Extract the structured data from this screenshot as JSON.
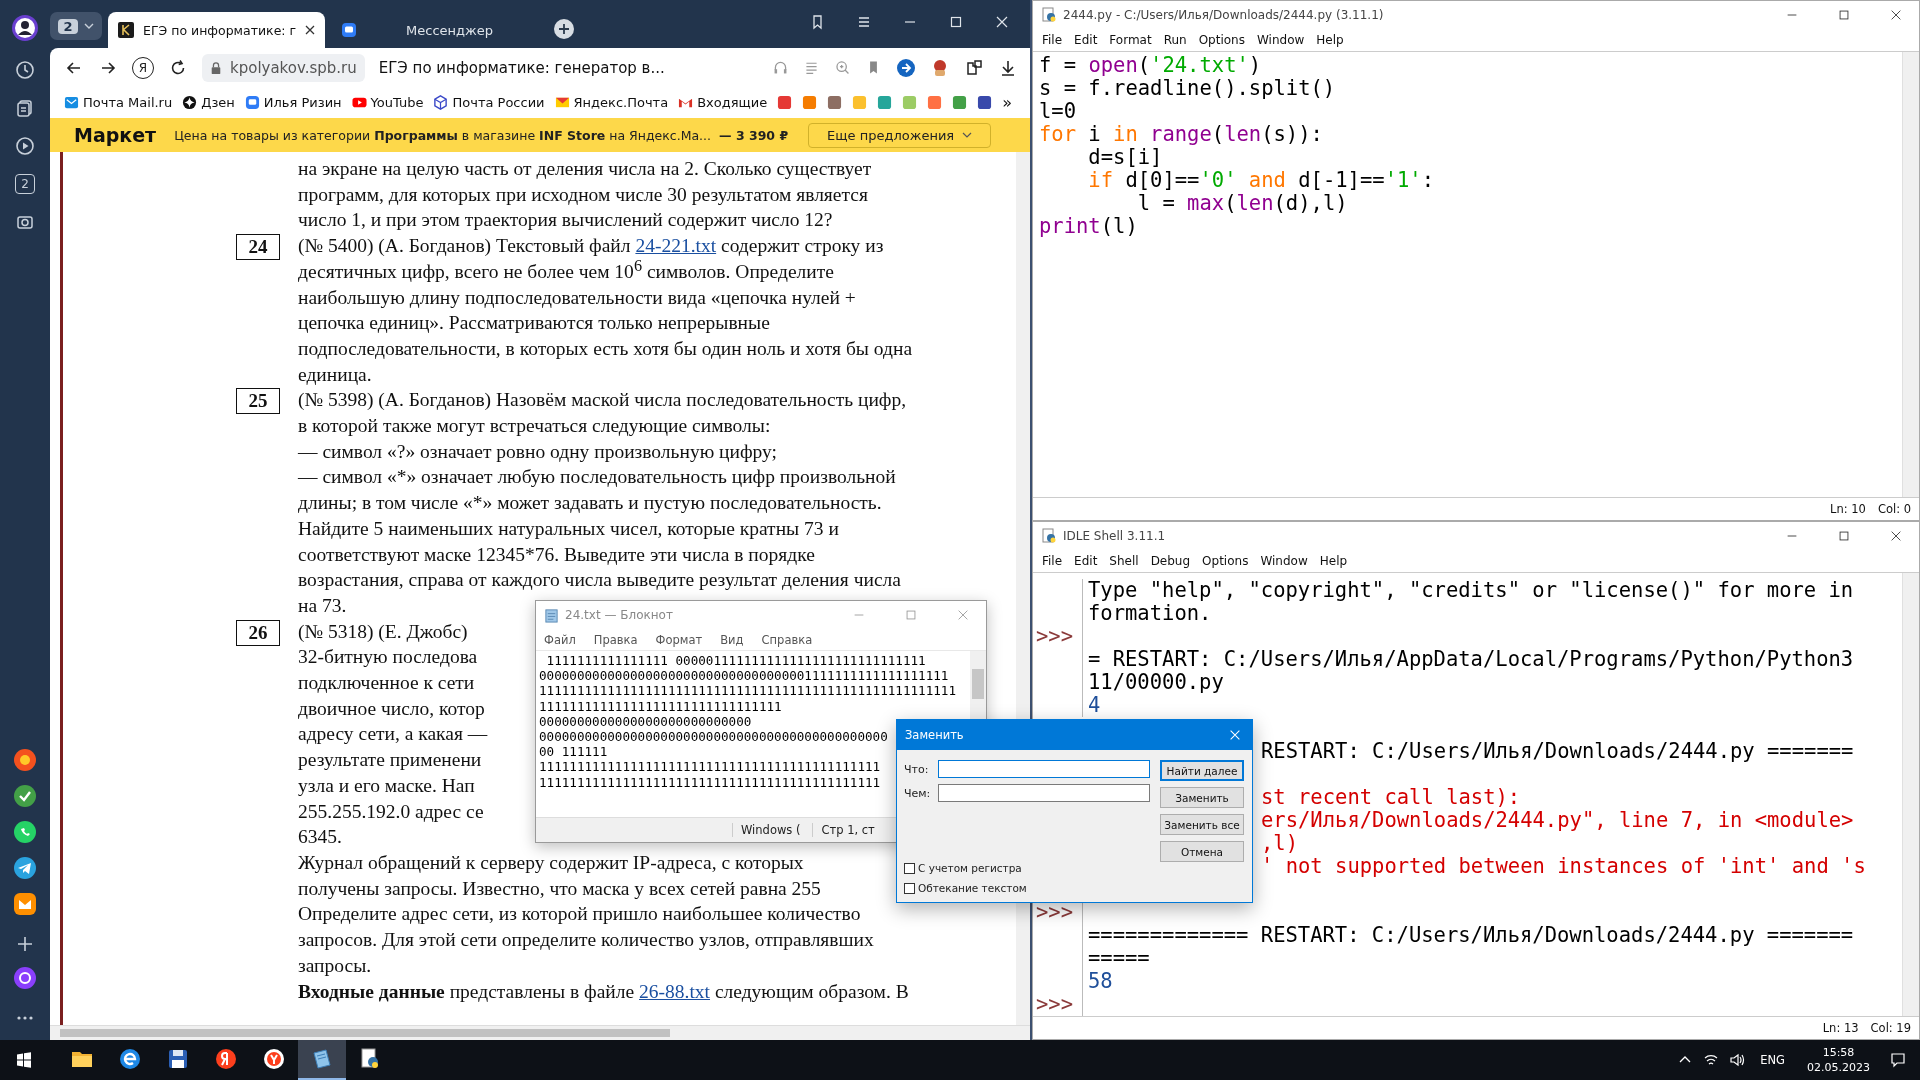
{
  "browser": {
    "profile_badge": "2",
    "tabs": [
      {
        "title": "ЕГЭ по информатике: г",
        "selected": true
      },
      {
        "title": "Мессенджер",
        "selected": false
      }
    ],
    "toolbar": {
      "yandex_button": "Я",
      "domain": "kpolyakov.spb.ru",
      "page_title": "ЕГЭ по информатике: генератор в..."
    },
    "bookmarks": [
      {
        "label": "Почта Mail.ru",
        "kind": "mail"
      },
      {
        "label": "Дзен",
        "kind": "dzen"
      },
      {
        "label": "Илья Ризин",
        "kind": "messenger"
      },
      {
        "label": "YouTube",
        "kind": "youtube"
      },
      {
        "label": "Почта России",
        "kind": "post"
      },
      {
        "label": "Яндекс.Почта",
        "kind": "envelope"
      },
      {
        "label": "Входящие",
        "kind": "gmail"
      }
    ],
    "extensions": [
      {
        "color": "#e53935"
      },
      {
        "color": "#f57c00"
      },
      {
        "color": "#8d6e63"
      },
      {
        "color": "#fbc02d"
      },
      {
        "color": "#26a69a"
      },
      {
        "color": "#9ccc65"
      },
      {
        "color": "#ff7043"
      },
      {
        "color": "#43a047"
      },
      {
        "color": "#3949ab"
      }
    ],
    "bookmarks_more": "»",
    "sidebar": {
      "counter": "2"
    },
    "promo": {
      "brand": "Маркет",
      "text": "Цена на товары из категории **Программы** в магазине **INF Store** на Яндекс.Ма...",
      "price": "— 3 390 ₽",
      "button": "Еще предложения"
    },
    "document": {
      "items": [
        {
          "lines": [
            {
              "text": "на экране на целую часть от деления числа на 2. Сколько существует"
            },
            {
              "text": "программ, для которых при исходном числе 30 результатом является"
            },
            {
              "text": "число 1, и при этом траектория вычислений содержит число 12?"
            }
          ]
        },
        {
          "number": "24",
          "lines": [
            {
              "text": "(№ 5400) (А. Богданов) Текстовый файл ",
              "link": "24-221.txt",
              "after": " содержит строку из"
            },
            {
              "text": "десятичных цифр, всего не более чем 10$^{6}$ символов. Определите"
            },
            {
              "text": "наибольшую длину подпоследовательности вида «цепочка нулей +"
            },
            {
              "text": "цепочка единиц». Рассматриваются только непрерывные"
            },
            {
              "text": "подпоследовательности, в которых есть хотя бы один ноль и хотя бы одна"
            },
            {
              "text": "единица."
            }
          ]
        },
        {
          "number": "25",
          "lines": [
            {
              "text": "(№ 5398) (А. Богданов) Назовём маской числа последовательность цифр,"
            },
            {
              "text": "в которой также могут встречаться следующие символы:"
            },
            {
              "text": "— символ «?» означает ровно одну произвольную цифру;"
            },
            {
              "text": "— символ «*» означает любую последовательность цифр произвольной"
            },
            {
              "text": "длины; в том числе «*» может задавать и пустую последовательность."
            },
            {
              "text": "Найдите 5 наименьших натуральных чисел, которые кратны 73 и"
            },
            {
              "text": "соответствуют маске 12345*76. Выведите эти числа в порядке"
            },
            {
              "text": "возрастания, справа от каждого числа выведите результат деления числа"
            },
            {
              "text": "на 73."
            }
          ]
        },
        {
          "number": "26",
          "lines": [
            {
              "text": "(№ 5318) (Е. Джобс)"
            },
            {
              "text": "32-битную последова"
            },
            {
              "text": "подключенное к сети"
            },
            {
              "text": "двоичное число, котор"
            },
            {
              "text": "адресу сети, а какая —"
            },
            {
              "text": "результате применени"
            },
            {
              "text": "узла и его маске. Нап"
            },
            {
              "text": "255.255.192.0 адрес се"
            },
            {
              "text": "6345."
            },
            {
              "text": "Журнал обращений к серверу содержит IP-адреса, с которых"
            },
            {
              "text": "получены запросы. Известно, что маска у всех сетей равна 255"
            },
            {
              "text": "Определите адрес сети, из которой пришло наибольшее количество"
            },
            {
              "text": "запросов. Для этой сети определите количество узлов, отправлявших"
            },
            {
              "text": "запросы."
            },
            {
              "text": "**Входные данные** представлены в файле ",
              "link": "26-88.txt",
              "after": " следующим образом. В"
            }
          ]
        }
      ]
    }
  },
  "editor": {
    "title": "2444.py - C:/Users/Илья/Downloads/2444.py (3.11.1)",
    "menu": [
      "File",
      "Edit",
      "Format",
      "Run",
      "Options",
      "Window",
      "Help"
    ],
    "code": [
      [
        {
          "t": "f = ",
          "kind": "plain"
        },
        {
          "t": "open",
          "kind": "builtin"
        },
        {
          "t": "(",
          "kind": "plain"
        },
        {
          "t": "'24.txt'",
          "kind": "string"
        },
        {
          "t": ")",
          "kind": "plain"
        }
      ],
      [
        {
          "t": "s = f.readline().split()",
          "kind": "plain"
        }
      ],
      [
        {
          "t": "l=0",
          "kind": "plain"
        }
      ],
      [
        {
          "t": "for",
          "kind": "keyword"
        },
        {
          "t": " i ",
          "kind": "plain"
        },
        {
          "t": "in",
          "kind": "keyword"
        },
        {
          "t": " range",
          "kind": "builtin"
        },
        {
          "t": "(",
          "kind": "plain"
        },
        {
          "t": "len",
          "kind": "builtin"
        },
        {
          "t": "(s)):",
          "kind": "plain"
        }
      ],
      [
        {
          "t": "    d=s[i]",
          "kind": "plain"
        }
      ],
      [
        {
          "t": "    if",
          "kind": "keyword"
        },
        {
          "t": " d[0]==",
          "kind": "plain"
        },
        {
          "t": "'0'",
          "kind": "string"
        },
        {
          "t": " and",
          "kind": "keyword"
        },
        {
          "t": " d[-1]==",
          "kind": "plain"
        },
        {
          "t": "'1'",
          "kind": "string"
        },
        {
          "t": ":",
          "kind": "plain"
        }
      ],
      [
        {
          "t": "        l = ",
          "kind": "plain"
        },
        {
          "t": "max",
          "kind": "builtin"
        },
        {
          "t": "(",
          "kind": "plain"
        },
        {
          "t": "len",
          "kind": "builtin"
        },
        {
          "t": "(d),l)",
          "kind": "plain"
        }
      ],
      [
        {
          "t": "print",
          "kind": "builtin"
        },
        {
          "t": "(l)",
          "kind": "plain"
        }
      ]
    ],
    "status": [
      "Ln: 10",
      "Col: 0"
    ]
  },
  "shell": {
    "title": "IDLE Shell 3.11.1",
    "menu": [
      "File",
      "Edit",
      "Shell",
      "Debug",
      "Options",
      "Window",
      "Help"
    ],
    "blocks": [
      [
        {
          "kind": "info",
          "text": "Type \"help\", \"copyright\", \"credits\" or \"license()\" for more in"
        },
        {
          "kind": "info",
          "text": "formation."
        },
        {
          "kind": "prompt",
          "text": ">>>"
        },
        {
          "kind": "info",
          "text": "= RESTART: C:/Users/Илья/AppData/Local/Programs/Python/Python3"
        },
        {
          "kind": "info",
          "text": "11/00000.py"
        },
        {
          "kind": "output",
          "text": "4"
        }
      ],
      [
        {
          "kind": "info",
          "text": "RESTART: C:/Users/Илья/Downloads/2444.py =======",
          "covered": true
        }
      ],
      [
        {
          "kind": "error",
          "text": "st recent call last):",
          "covered": true
        },
        {
          "kind": "error",
          "text": "ers/Илья/Downloads/2444.py\", line 7, in <module>",
          "covered": true
        },
        {
          "kind": "error",
          "text": ",l)",
          "covered": true
        },
        {
          "kind": "error",
          "text": "' not supported between instances of 'int' and 's",
          "covered": true
        }
      ],
      [
        {
          "kind": "prompt",
          "text": ">>>"
        },
        {
          "kind": "info",
          "text": "============= RESTART: C:/Users/Илья/Downloads/2444.py ======="
        },
        {
          "kind": "info",
          "text": "====="
        },
        {
          "kind": "output",
          "text": "58"
        },
        {
          "kind": "prompt",
          "text": ">>>"
        }
      ]
    ],
    "status": [
      "Ln: 13",
      "Col: 19"
    ]
  },
  "notepad": {
    "title": "24.txt — Блокнот",
    "menu": [
      "Файл",
      "Правка",
      "Формат",
      "Вид",
      "Справка"
    ],
    "lines": [
      " 1111111111111111 000001111111111111111111111111111",
      "000000000000000000000000000000000001111111111111111111",
      "1111111111111111111111111111111111111111111111111111111",
      "11111111111111111111111111111111",
      "0000000000000000000000000000",
      "0000000000000000000000000000000000000000000000",
      "00 111111",
      "111111111111111111111111111111111111111111111",
      "111111111111111111111111111111111111111111111"
    ],
    "status": [
      "Windows (",
      "Стр 1, ст"
    ]
  },
  "replace_dialog": {
    "title": "Заменить",
    "fields": [
      {
        "label": "Что:"
      },
      {
        "label": "Чем:"
      }
    ],
    "buttons": [
      {
        "label": "Найти далее",
        "default": true
      },
      {
        "label": "Заменить",
        "default": false
      },
      {
        "label": "Заменить все",
        "default": false
      },
      {
        "label": "Отмена",
        "default": false
      }
    ],
    "checkboxes": [
      {
        "label": "С учетом регистра",
        "checked": false
      },
      {
        "label": "Обтекание текстом",
        "checked": false
      }
    ]
  },
  "taskbar": {
    "apps": [
      {
        "kind": "explorer",
        "active": false
      },
      {
        "kind": "edge",
        "active": false
      },
      {
        "kind": "floppy",
        "active": false
      },
      {
        "kind": "yandex",
        "active": false
      },
      {
        "kind": "browser",
        "active": false
      },
      {
        "kind": "notepad",
        "active": true
      },
      {
        "kind": "python",
        "active": false
      }
    ],
    "language": "ENG",
    "time": "15:58",
    "date": "02.05.2023"
  }
}
